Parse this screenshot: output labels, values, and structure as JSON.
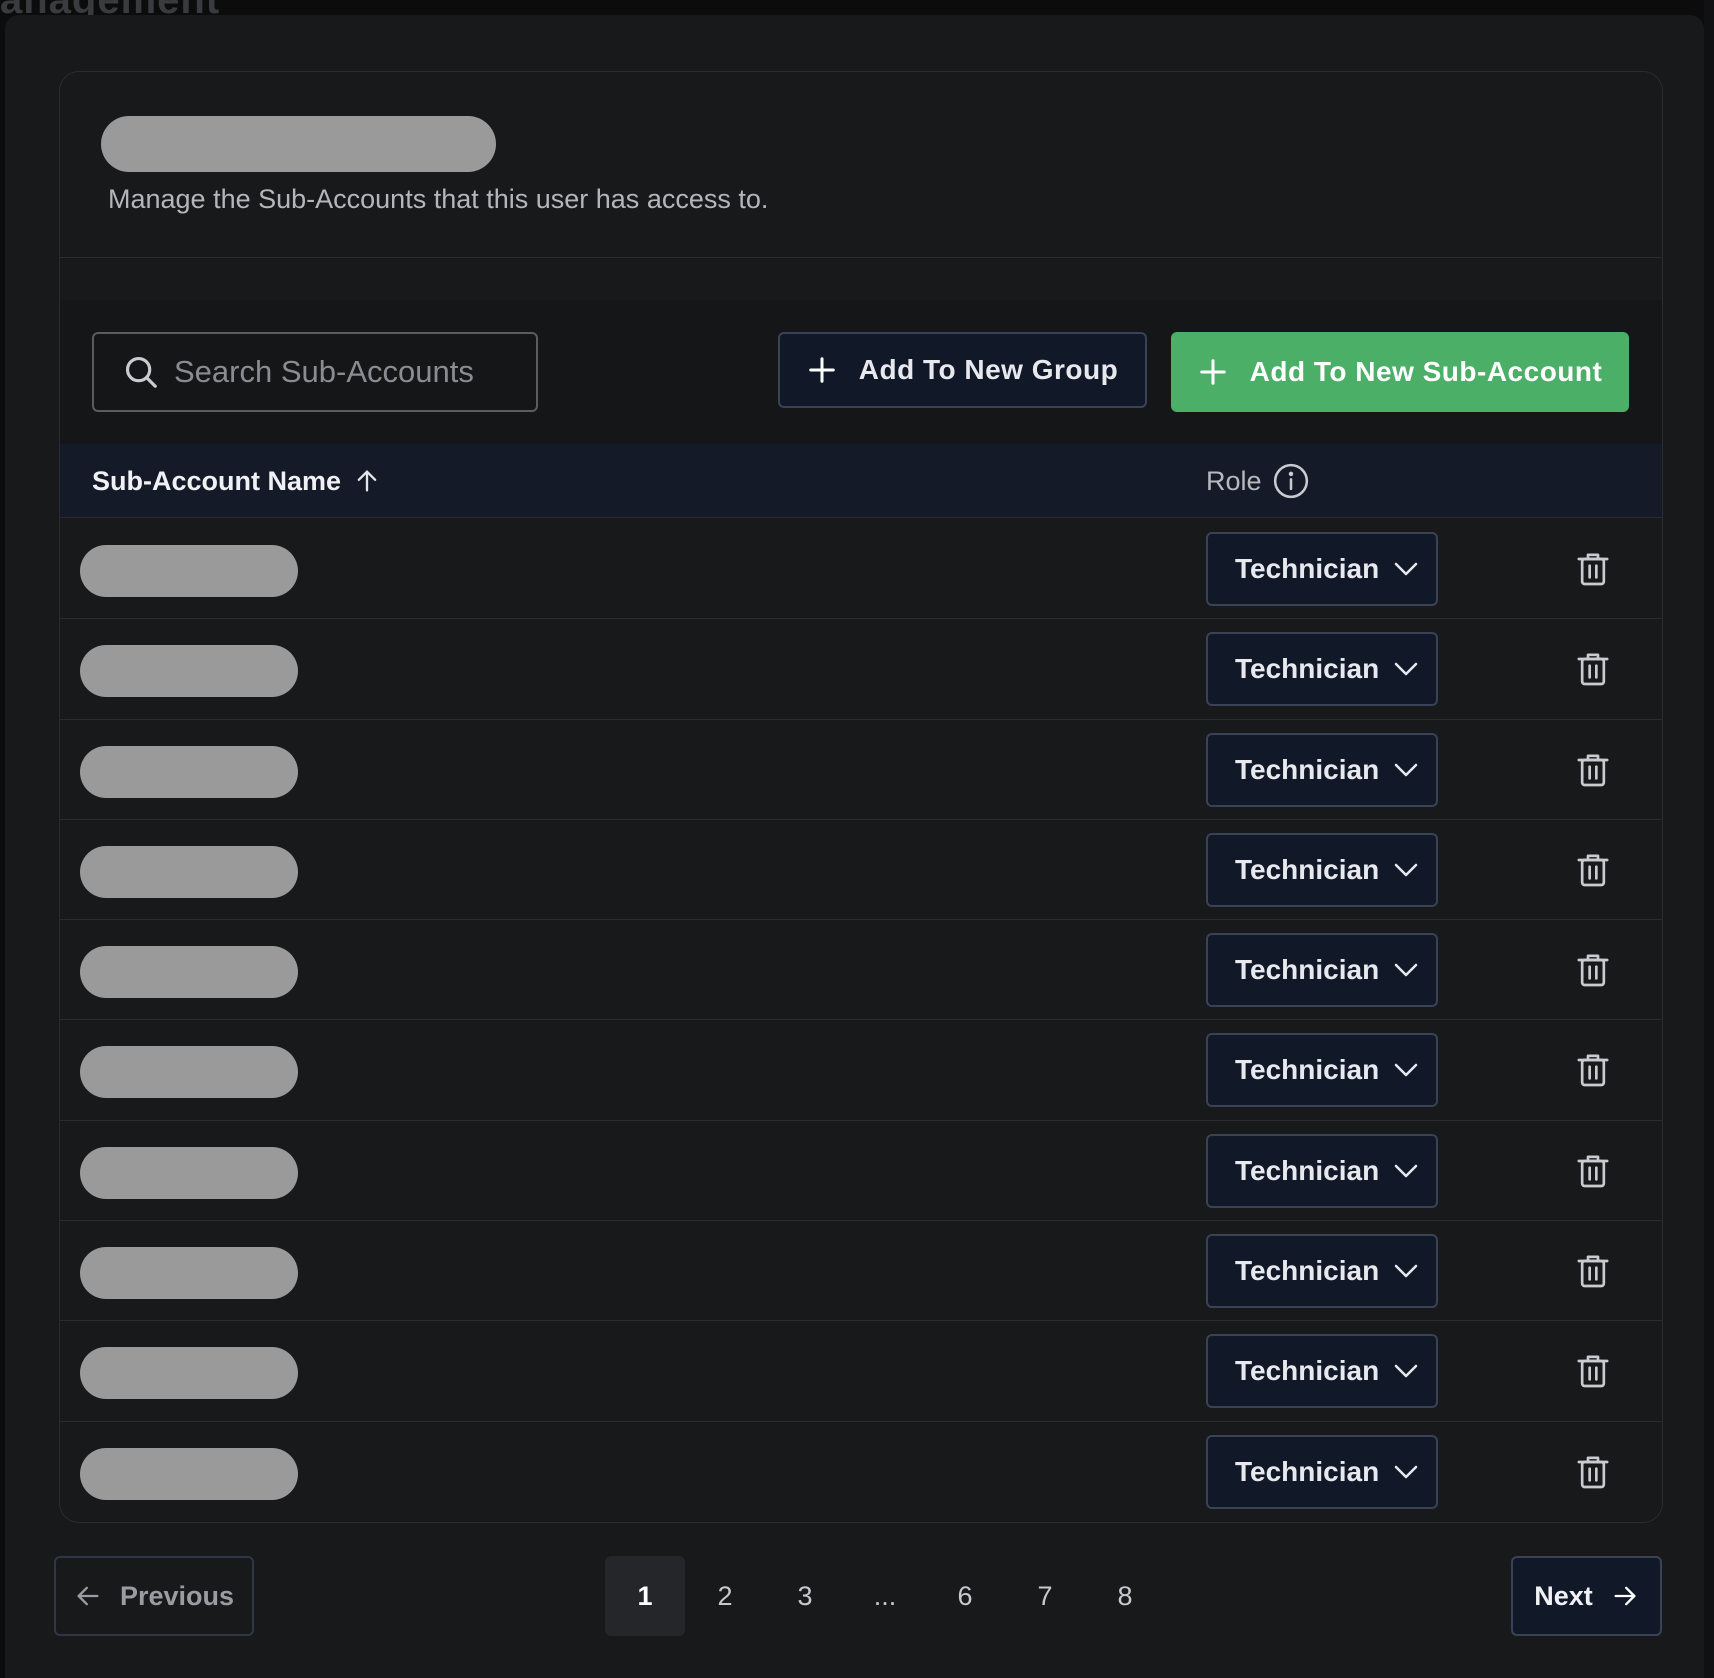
{
  "background": {
    "title_fragment": "anagement"
  },
  "card": {
    "description": "Manage the Sub-Accounts that this user has access to."
  },
  "toolbar": {
    "search_placeholder": "Search Sub-Accounts",
    "add_group_label": "Add To New Group",
    "add_subaccount_label": "Add To New Sub-Account"
  },
  "table": {
    "col_name": "Sub-Account Name",
    "col_role": "Role",
    "sort_direction": "ascending",
    "rows": [
      {
        "role": "Technician"
      },
      {
        "role": "Technician"
      },
      {
        "role": "Technician"
      },
      {
        "role": "Technician"
      },
      {
        "role": "Technician"
      },
      {
        "role": "Technician"
      },
      {
        "role": "Technician"
      },
      {
        "role": "Technician"
      },
      {
        "role": "Technician"
      },
      {
        "role": "Technician"
      }
    ]
  },
  "pagination": {
    "previous_label": "Previous",
    "next_label": "Next",
    "pages": [
      "1",
      "2",
      "3",
      "...",
      "6",
      "7",
      "8"
    ],
    "current_page": "1"
  },
  "colors": {
    "accent_green": "#4caf68",
    "button_navy": "#111827",
    "surface": "#18191b"
  },
  "icons": {
    "search": "search-icon",
    "plus": "plus-icon",
    "sort": "arrow-up-icon",
    "info": "info-icon",
    "chevron": "chevron-down-icon",
    "delete": "trash-icon",
    "prev": "arrow-left-icon",
    "next": "arrow-right-icon"
  }
}
